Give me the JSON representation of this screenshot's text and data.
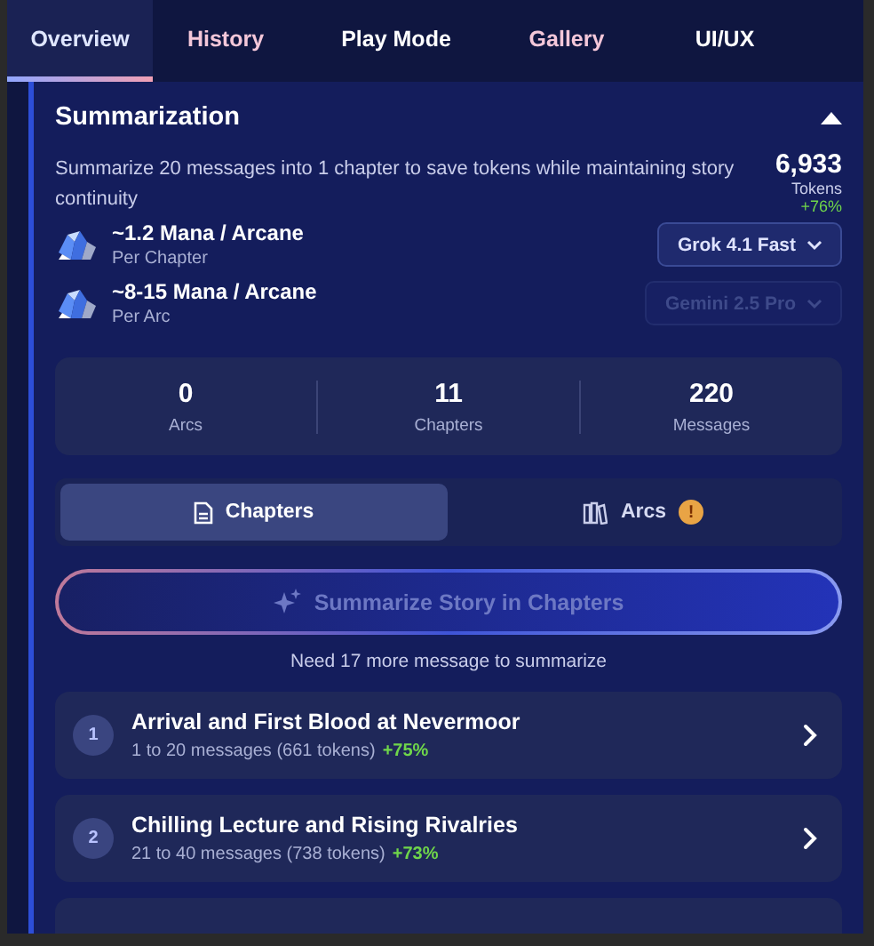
{
  "tabs": [
    {
      "label": "Overview",
      "selected": true,
      "color": "#dfe6ff"
    },
    {
      "label": "History",
      "selected": false,
      "color": "#f4c7d9"
    },
    {
      "label": "Play Mode",
      "selected": false,
      "color": "#ffffff"
    },
    {
      "label": "Gallery",
      "selected": false,
      "color": "#f4c7d9"
    },
    {
      "label": "UI/UX",
      "selected": false,
      "color": "#ffffff"
    }
  ],
  "summarization": {
    "title": "Summarization",
    "expanded": true,
    "description": "Summarize 20 messages into 1 chapter to save tokens while maintaining story continuity",
    "tokens": {
      "value": "6,933",
      "label": "Tokens",
      "change": "+76%"
    },
    "costs": [
      {
        "amount": "~1.2 Mana / Arcane",
        "unit": "Per Chapter",
        "model": "Grok 4.1 Fast",
        "disabled": false
      },
      {
        "amount": "~8-15 Mana / Arcane",
        "unit": "Per Arc",
        "model": "Gemini 2.5 Pro",
        "disabled": true
      }
    ],
    "stats": [
      {
        "value": "0",
        "label": "Arcs"
      },
      {
        "value": "11",
        "label": "Chapters"
      },
      {
        "value": "220",
        "label": "Messages"
      }
    ],
    "views": [
      {
        "label": "Chapters",
        "selected": true,
        "kind": "document"
      },
      {
        "label": "Arcs",
        "selected": false,
        "kind": "books",
        "badge": "!"
      }
    ],
    "action": {
      "label": "Summarize Story in Chapters",
      "disabled": true
    },
    "hint": "Need 17 more message to summarize",
    "chapters": [
      {
        "number": "1",
        "title": "Arrival and First Blood at Nevermoor",
        "range": "1 to 20 messages (661 tokens)",
        "change": "+75%"
      },
      {
        "number": "2",
        "title": "Chilling Lecture and Rising Rivalries",
        "range": "21 to 40 messages (738 tokens)",
        "change": "+73%"
      }
    ],
    "more_below": true
  }
}
